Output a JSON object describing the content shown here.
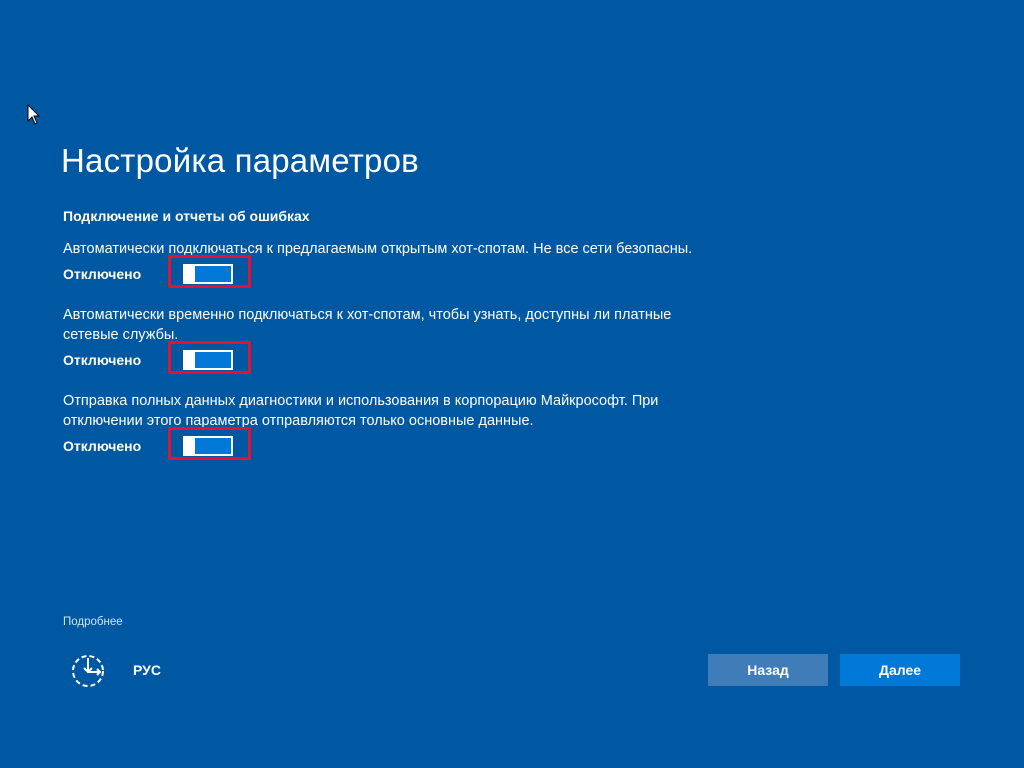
{
  "page": {
    "title": "Настройка параметров",
    "section_heading": "Подключение и отчеты об ошибках"
  },
  "settings": [
    {
      "description": "Автоматически подключаться к предлагаемым открытым хот-спотам. Не все сети безопасны.",
      "state_label": "Отключено",
      "enabled": false
    },
    {
      "description": "Автоматически временно подключаться к хот-спотам, чтобы узнать, доступны ли платные сетевые службы.",
      "state_label": "Отключено",
      "enabled": false
    },
    {
      "description": "Отправка полных данных диагностики и использования в корпорацию Майкрософт. При отключении этого параметра отправляются только основные данные.",
      "state_label": "Отключено",
      "enabled": false
    }
  ],
  "footer": {
    "more_link": "Подробнее",
    "language": "РУС",
    "back_label": "Назад",
    "next_label": "Далее"
  },
  "icons": {
    "cursor": "mouse-pointer-icon",
    "accessibility": "ease-of-access-icon"
  },
  "colors": {
    "background": "#0058a3",
    "toggle_fill": "#0078d7",
    "highlight": "#e8112d",
    "back_button": "#3f7cb8",
    "next_button": "#0078d7"
  }
}
